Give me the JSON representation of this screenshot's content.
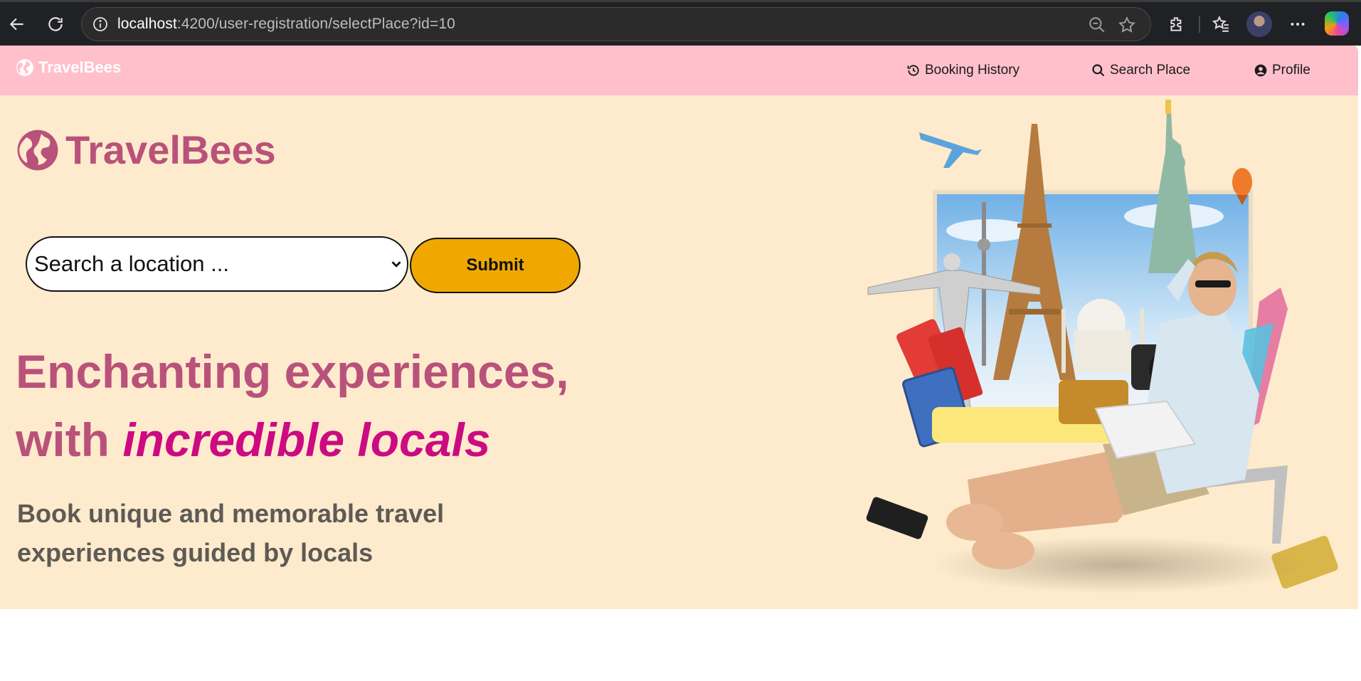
{
  "browser": {
    "url_host": "localhost",
    "url_rest": ":4200/user-registration/selectPlace?id=10",
    "icons": [
      "back-arrow-icon",
      "reload-icon",
      "info-icon",
      "zoom-out-icon",
      "favorite-star-icon",
      "extensions-icon",
      "favorites-icon",
      "more-icon"
    ]
  },
  "navbar": {
    "brand": "TravelBees",
    "links": [
      {
        "label": "Booking History",
        "icon": "history-icon"
      },
      {
        "label": "Search Place",
        "icon": "search-icon"
      },
      {
        "label": "Profile",
        "icon": "user-circle-icon"
      }
    ]
  },
  "hero": {
    "brand": "TravelBees",
    "search": {
      "value": "Search a location ..."
    },
    "submit_label": "Submit",
    "headline_line1": "Enchanting experiences,",
    "headline_with": "with ",
    "headline_accent": "incredible locals",
    "subtext": "Book unique and memorable travel experiences guided by locals"
  },
  "colors": {
    "navbar": "#ffc0cb",
    "hero_bg": "#feebcd",
    "brand": "#b9527a",
    "accent": "#cc0a82",
    "button": "#f0a800"
  }
}
